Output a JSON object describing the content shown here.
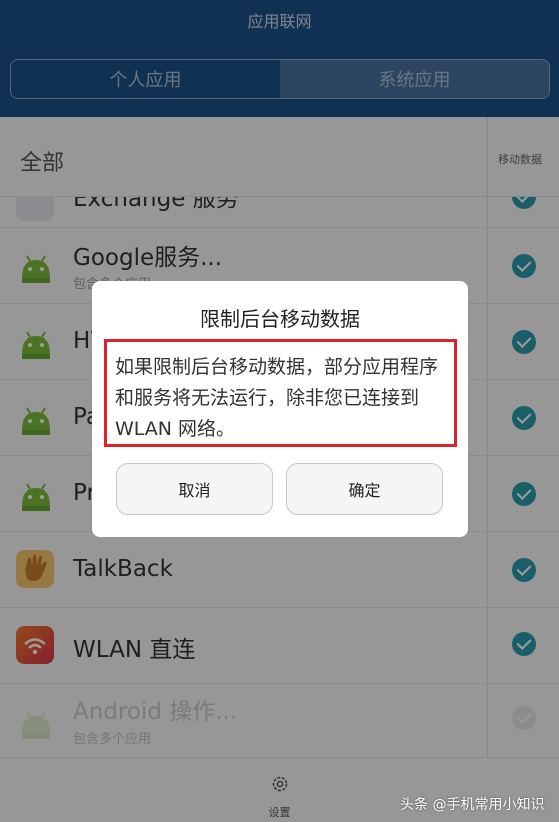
{
  "header": {
    "title": "应用联网",
    "tabs": [
      {
        "label": "个人应用",
        "active": true
      },
      {
        "label": "系统应用",
        "active": false
      }
    ]
  },
  "list": {
    "header_label": "全部",
    "column_label": "移动数据",
    "rows": [
      {
        "title": "Exchange 服务",
        "subtitle": "",
        "icon": "exchange-icon",
        "checked": true
      },
      {
        "title": "Google服务...",
        "subtitle": "包含多个应用",
        "icon": "android-icon",
        "checked": true
      },
      {
        "title": "HW",
        "subtitle": "",
        "icon": "android-icon",
        "checked": true
      },
      {
        "title": "Pa",
        "subtitle": "",
        "icon": "android-icon",
        "checked": true
      },
      {
        "title": "Pr",
        "subtitle": "",
        "icon": "android-icon",
        "checked": true
      },
      {
        "title": "TalkBack",
        "subtitle": "",
        "icon": "hand-icon",
        "checked": true
      },
      {
        "title": "WLAN 直连",
        "subtitle": "",
        "icon": "wifi-icon",
        "checked": true
      },
      {
        "title": "Android 操作...",
        "subtitle": "包含多个应用",
        "icon": "android-icon",
        "checked": false
      }
    ]
  },
  "dialog": {
    "title": "限制后台移动数据",
    "message": "如果限制后台移动数据，部分应用程序和服务将无法运行，除非您已连接到 WLAN 网络。",
    "cancel_label": "取消",
    "ok_label": "确定"
  },
  "bottom_bar": {
    "settings_label": "设置"
  },
  "watermark": "头条 @手机常用小知识",
  "colors": {
    "header_bg": "#1c4f86",
    "check": "#2a9aa8",
    "highlight_border": "#e0202a"
  }
}
